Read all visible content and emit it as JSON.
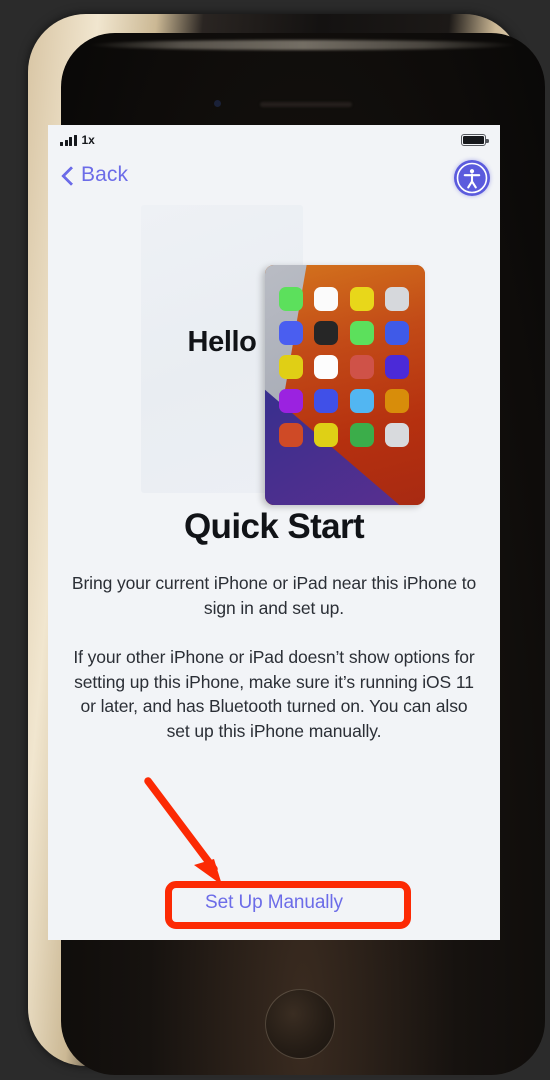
{
  "device": {
    "type": "iphone",
    "home_button": "home-button",
    "bezel_color": "#d8c5a4",
    "body_color": "#16120f"
  },
  "status_bar": {
    "signal_bars": 4,
    "carrier_text": "1x",
    "battery_level_percent": 100
  },
  "nav_bar": {
    "back_label": "Back",
    "back_icon": "chevron-left-icon",
    "accessibility_icon": "accessibility-icon",
    "accent_color": "#6c6ce8"
  },
  "hero": {
    "hello_text": "Hello",
    "grid_icon_colors": [
      "#5ce05c",
      "#fbfbfb",
      "#e8d71a",
      "#d6d8dc",
      "#4a5ef0",
      "#262626",
      "#5ce05c",
      "#3f5ae8",
      "#e0cf15",
      "#fdfdfd",
      "#cf5248",
      "#4b2ad8",
      "#9b22e0",
      "#4050e8",
      "#52b6f2",
      "#d88d0a",
      "#cf4a26",
      "#dfd015",
      "#3bad4a",
      "#d8dadd"
    ]
  },
  "main": {
    "title": "Quick Start",
    "paragraph_1": "Bring your current iPhone or iPad near this iPhone to sign in and set up.",
    "paragraph_2": "If your other iPhone or iPad doesn’t show options for setting up this iPhone, make sure it’s running iOS 11 or later, and has Bluetooth turned on. You can also set up this iPhone manually.",
    "setup_manually_label": "Set Up Manually"
  },
  "annotations": {
    "highlight_color": "#fc2a04",
    "arrow_target": "Set Up Manually",
    "highlight_target": "Set Up Manually"
  }
}
